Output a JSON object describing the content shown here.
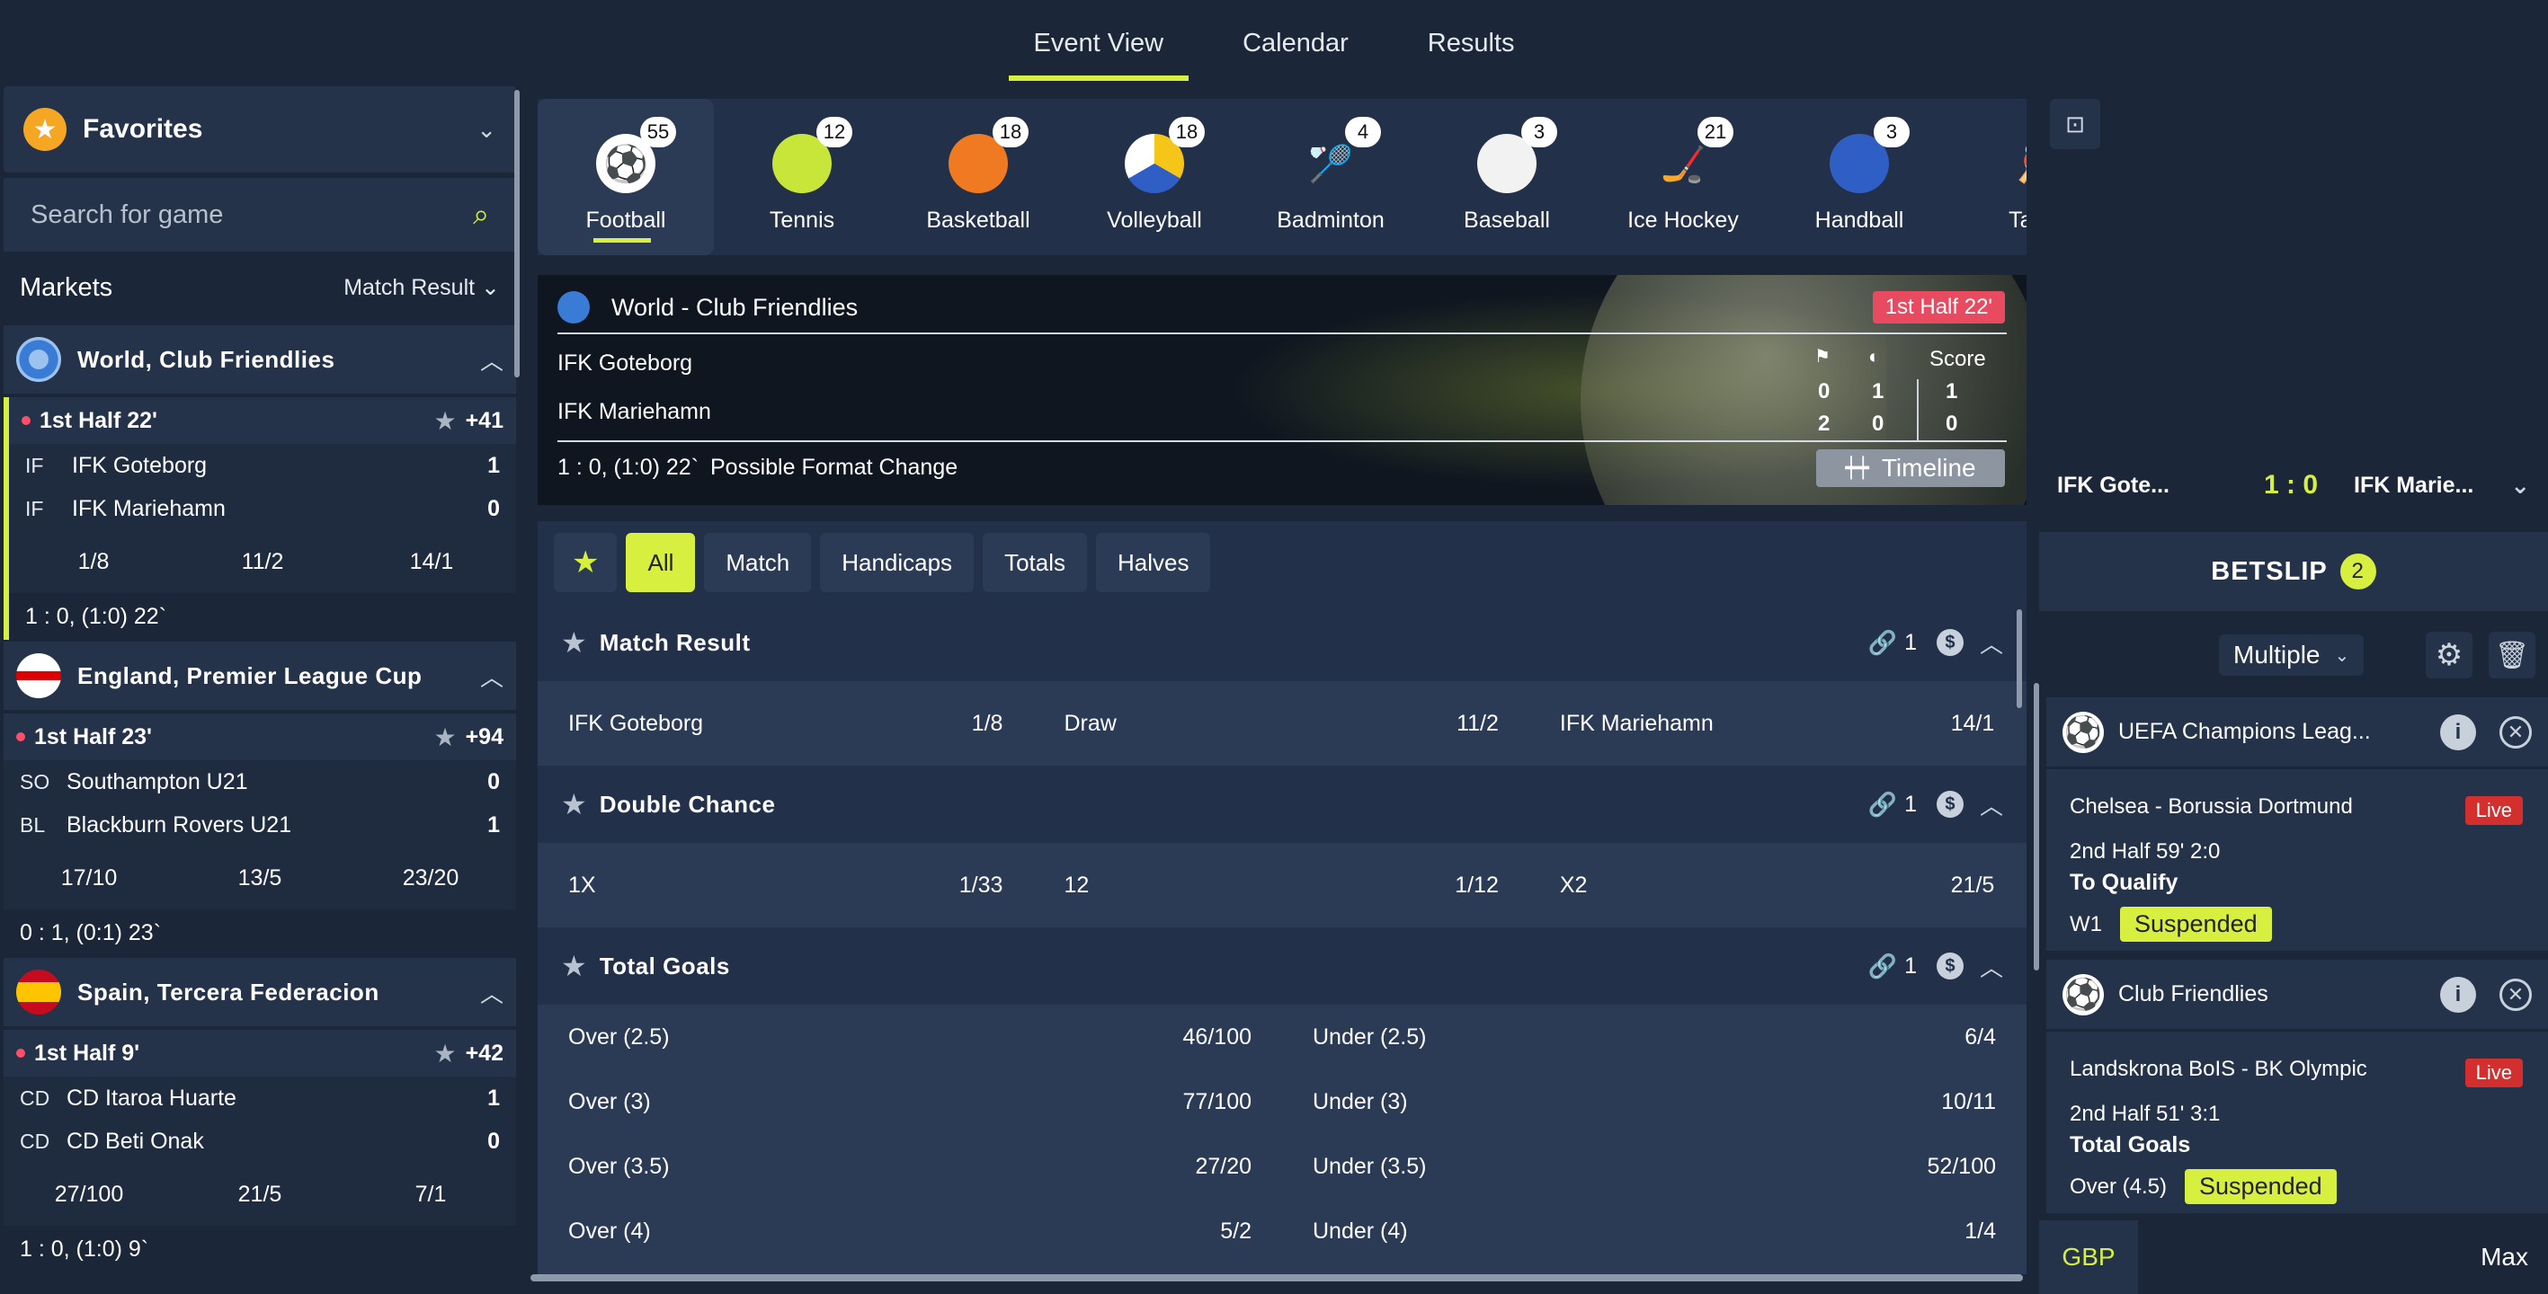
{
  "topnav": {
    "tabs": [
      "Event View",
      "Calendar",
      "Results"
    ]
  },
  "sidebar": {
    "favorites": "Favorites",
    "search_placeholder": "Search for game",
    "markets_label": "Markets",
    "markets_value": "Match Result",
    "leagues": [
      {
        "name": "World, Club Friendlies",
        "match": {
          "status": "1st Half 22'",
          "more": "+41",
          "team1": {
            "abbr": "IF",
            "name": "IFK Goteborg",
            "score": "1"
          },
          "team2": {
            "abbr": "IF",
            "name": "IFK Mariehamn",
            "score": "0"
          },
          "odds": [
            "1/8",
            "11/2",
            "14/1"
          ],
          "footer": "1 : 0, (1:0) 22`"
        }
      },
      {
        "name": "England, Premier League Cup",
        "match": {
          "status": "1st Half 23'",
          "more": "+94",
          "team1": {
            "abbr": "SO",
            "name": "Southampton U21",
            "score": "0"
          },
          "team2": {
            "abbr": "BL",
            "name": "Blackburn Rovers U21",
            "score": "1"
          },
          "odds": [
            "17/10",
            "13/5",
            "23/20"
          ],
          "footer": "0 : 1, (0:1) 23`"
        }
      },
      {
        "name": "Spain, Tercera Federacion",
        "match": {
          "status": "1st Half 9'",
          "more": "+42",
          "team1": {
            "abbr": "CD",
            "name": "CD Itaroa Huarte",
            "score": "1"
          },
          "team2": {
            "abbr": "CD",
            "name": "CD Beti Onak",
            "score": "0"
          },
          "odds": [
            "27/100",
            "21/5",
            "7/1"
          ],
          "footer": "1 : 0, (1:0) 9`"
        }
      }
    ]
  },
  "sports": [
    {
      "name": "Football",
      "count": "55"
    },
    {
      "name": "Tennis",
      "count": "12"
    },
    {
      "name": "Basketball",
      "count": "18"
    },
    {
      "name": "Volleyball",
      "count": "18"
    },
    {
      "name": "Badminton",
      "count": "4"
    },
    {
      "name": "Baseball",
      "count": "3"
    },
    {
      "name": "Ice Hockey",
      "count": "21"
    },
    {
      "name": "Handball",
      "count": "3"
    },
    {
      "name": "Table",
      "count": ""
    }
  ],
  "hero": {
    "title": "World - Club Friendlies",
    "badge": "1st Half 22'",
    "team1": "IFK Goteborg",
    "team2": "IFK Mariehamn",
    "score_title": "Score",
    "corners": [
      "0",
      "2"
    ],
    "halves": [
      "1",
      "0"
    ],
    "score": [
      "1",
      "0"
    ],
    "footer_score": "1 : 0, (1:0) 22`",
    "footer_note": "Possible Format Change",
    "timeline": "Timeline"
  },
  "filters": [
    "All",
    "Match",
    "Handicaps",
    "Totals",
    "Halves"
  ],
  "markets": {
    "match_result": {
      "title": "Match Result",
      "count": "1",
      "cells": [
        [
          "IFK Goteborg",
          "1/8"
        ],
        [
          "Draw",
          "11/2"
        ],
        [
          "IFK Mariehamn",
          "14/1"
        ]
      ]
    },
    "double_chance": {
      "title": "Double Chance",
      "count": "1",
      "cells": [
        [
          "1X",
          "1/33"
        ],
        [
          "12",
          "1/12"
        ],
        [
          "X2",
          "21/5"
        ]
      ]
    },
    "total_goals": {
      "title": "Total Goals",
      "count": "1",
      "rows": [
        [
          [
            "Over (2.5)",
            "46/100"
          ],
          [
            "Under (2.5)",
            "6/4"
          ]
        ],
        [
          [
            "Over (3)",
            "77/100"
          ],
          [
            "Under (3)",
            "10/11"
          ]
        ],
        [
          [
            "Over (3.5)",
            "27/20"
          ],
          [
            "Under (3.5)",
            "52/100"
          ]
        ],
        [
          [
            "Over (4)",
            "5/2"
          ],
          [
            "Under (4)",
            "1/4"
          ]
        ]
      ]
    }
  },
  "right": {
    "team_a": "IFK Gote...",
    "score": "1 : 0",
    "team_b": "IFK Marie...",
    "betslip": "BETSLIP",
    "betslip_count": "2",
    "mode": "Multiple",
    "bets": [
      {
        "league": "UEFA Champions Leag...",
        "event": "Chelsea - Borussia Dortmund",
        "live": "Live",
        "state": "2nd Half 59' 2:0",
        "market": "To Qualify",
        "selection": "W1",
        "status": "Suspended"
      },
      {
        "league": "Club Friendlies",
        "event": "Landskrona BoIS - BK Olympic",
        "live": "Live",
        "state": "2nd Half 51' 3:1",
        "market": "Total Goals",
        "selection": "Over (4.5)",
        "status": "Suspended"
      }
    ],
    "currency": "GBP",
    "max": "Max"
  }
}
